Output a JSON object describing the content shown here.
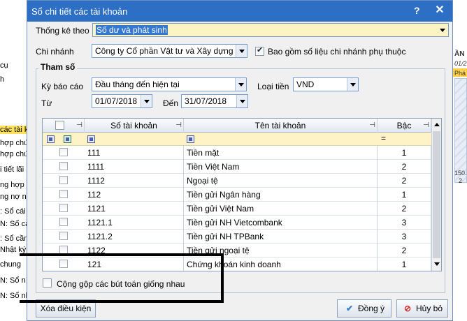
{
  "background": {
    "left_items": [
      {
        "text": "cụ",
        "hl": false
      },
      {
        "text": "h",
        "hl": false
      },
      {
        "text": "các tài k",
        "hl": true
      },
      {
        "text": "hợp chứ",
        "hl": false
      },
      {
        "text": "hợp chứ",
        "hl": false
      },
      {
        "text": "i tiết lãi",
        "hl": false
      },
      {
        "text": "ng hợp l",
        "hl": false
      },
      {
        "text": "ng nợ nh",
        "hl": false
      },
      {
        "text": ": Sổ cái",
        "hl": false
      },
      {
        "text": "N: Sổ cá",
        "hl": false
      },
      {
        "text": ": Sổ cần",
        "hl": false
      },
      {
        "text": "Nhật ký",
        "hl": false
      },
      {
        "text": "chung",
        "hl": false
      },
      {
        "text": "N: Sổ n",
        "hl": false
      },
      {
        "text": "N: Sổ nh",
        "hl": false
      }
    ],
    "right_fragments": [
      "ẦN",
      "01/2",
      "Phá",
      "150.",
      "2"
    ]
  },
  "dialog": {
    "title": "Sổ chi tiết các tài khoản",
    "help_glyph": "?",
    "close_glyph": "✕",
    "thong_ke": {
      "label": "Thống kê theo",
      "value": "Số dư và phát sinh"
    },
    "chi_nhanh": {
      "label": "Chi nhánh",
      "value": "Công ty Cổ phần Vật tư và Xây dựng 36"
    },
    "bao_gom": {
      "label": "Bao gồm số liệu chi nhánh phụ thuộc",
      "checked": true
    },
    "group_title": "Tham số",
    "ky_bao_cao": {
      "label": "Kỳ báo cáo",
      "value": "Đầu tháng đến hiện tại"
    },
    "loai_tien": {
      "label": "Loại tiền",
      "value": "VND"
    },
    "tu": {
      "label": "Từ",
      "value": "01/07/2018"
    },
    "den": {
      "label": "Đến",
      "value": "31/07/2018"
    },
    "grid": {
      "headers": {
        "so_tk": "Số tài khoản",
        "ten_tk": "Tên tài khoản",
        "bac": "Bậc"
      },
      "filter_eq": "=",
      "rows": [
        {
          "so": "111",
          "ten": "Tiền mặt",
          "bac": "1"
        },
        {
          "so": "1111",
          "ten": "Tiền Việt Nam",
          "bac": "2"
        },
        {
          "so": "1112",
          "ten": "Ngoại tệ",
          "bac": "2"
        },
        {
          "so": "112",
          "ten": "Tiền gửi Ngân hàng",
          "bac": "1"
        },
        {
          "so": "1121",
          "ten": "Tiền gửi Việt Nam",
          "bac": "2"
        },
        {
          "so": "1121.1",
          "ten": "Tiền gửi NH Vietcombank",
          "bac": "3"
        },
        {
          "so": "1121.2",
          "ten": "Tiền gửi NH TPBank",
          "bac": "3"
        },
        {
          "so": "1122",
          "ten": "Tiền gửi ngoại tệ",
          "bac": "2"
        },
        {
          "so": "121",
          "ten": "Chứng khoán kinh doanh",
          "bac": "1"
        }
      ]
    },
    "cong_gop": {
      "label": "Cộng gộp các bút toán giống nhau",
      "checked": false
    },
    "buttons": {
      "xoa": "Xóa điều kiện",
      "dong_y": "Đồng ý",
      "huy_bo": "Hủy bỏ"
    },
    "colors": {
      "titlebar": "#2c6fc4",
      "selection": "#3378d1",
      "filter_row": "#fdf3c6",
      "accent_cancel": "#d42a2a"
    }
  }
}
